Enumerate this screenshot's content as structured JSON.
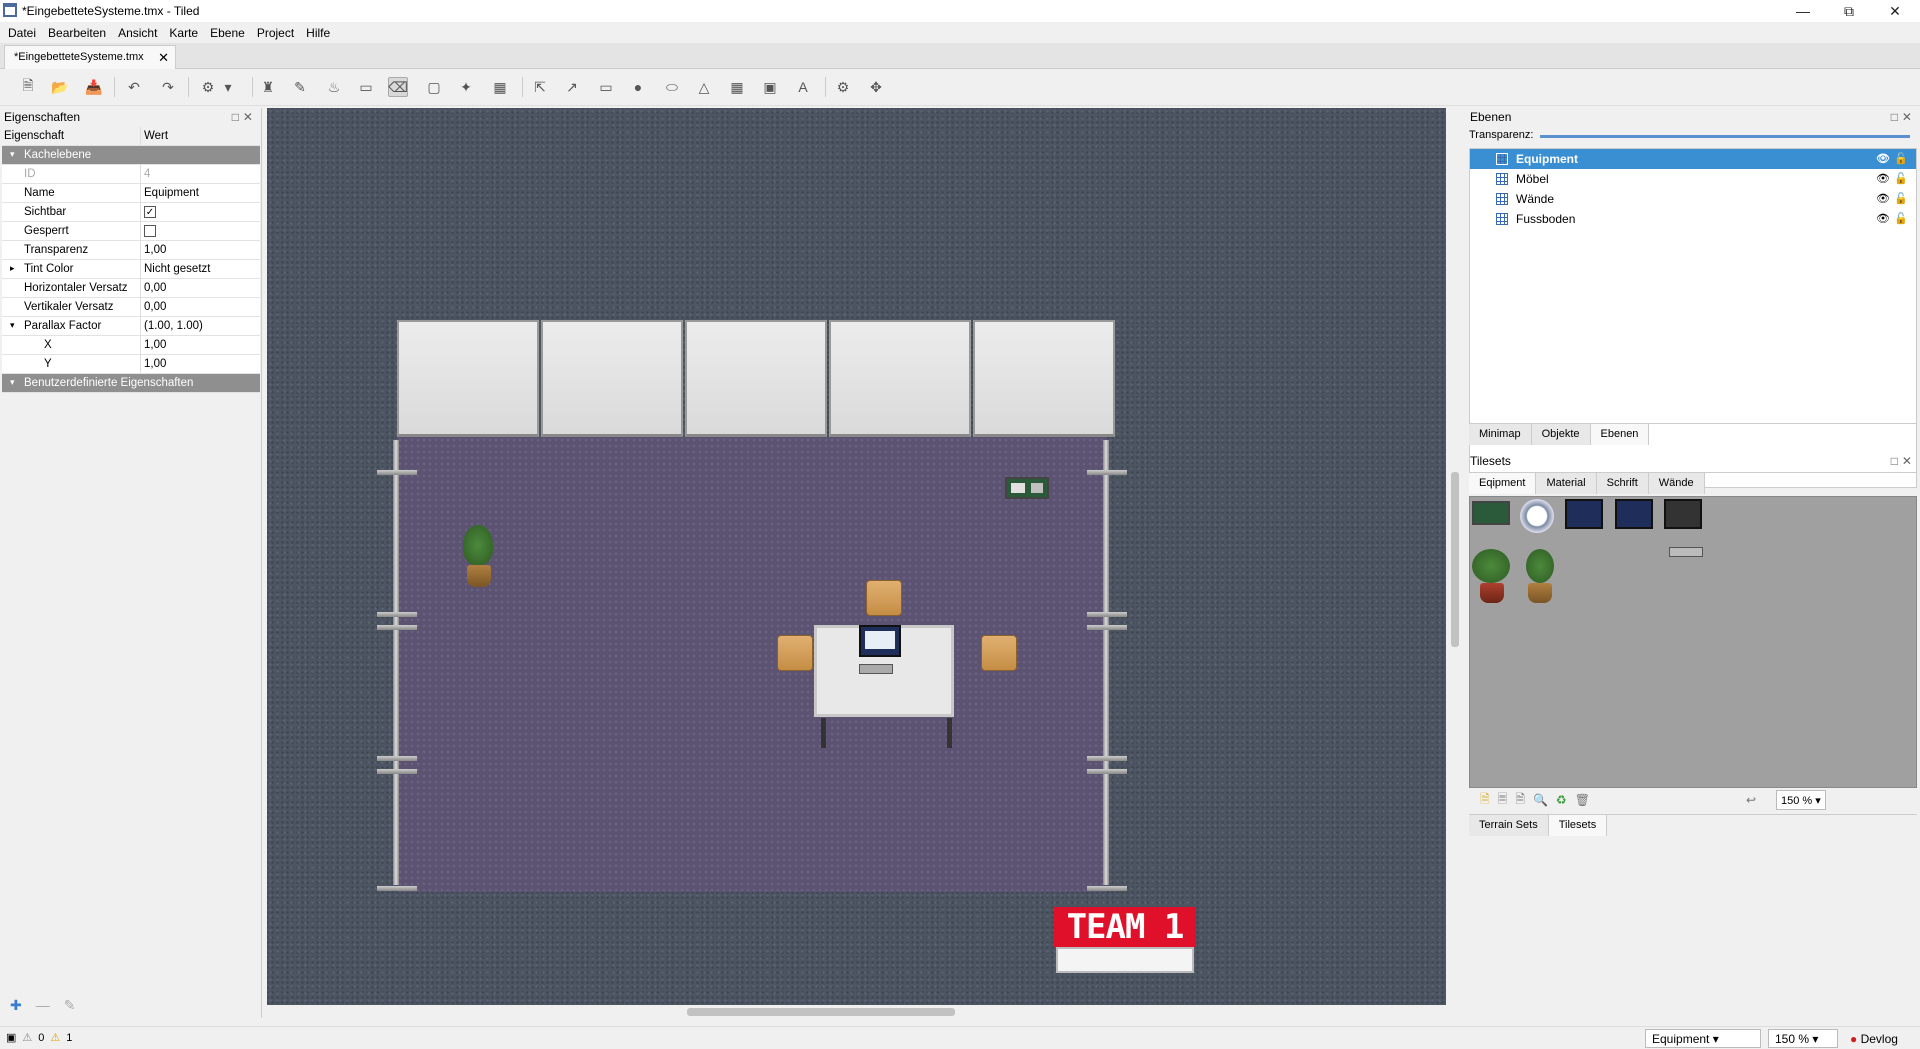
{
  "window": {
    "title": "*EingebetteteSysteme.tmx - Tiled"
  },
  "menu": [
    "Datei",
    "Bearbeiten",
    "Ansicht",
    "Karte",
    "Ebene",
    "Project",
    "Hilfe"
  ],
  "document_tab": {
    "label": "*EingebetteteSysteme.tmx"
  },
  "properties_panel": {
    "title": "Eigenschaften",
    "col_property": "Eigenschaft",
    "col_value": "Wert",
    "group_main": "Kachelebene",
    "rows": [
      {
        "key": "ID",
        "value": "4"
      },
      {
        "key": "Name",
        "value": "Equipment"
      },
      {
        "key": "Sichtbar",
        "value": "✓"
      },
      {
        "key": "Gesperrt",
        "value": ""
      },
      {
        "key": "Transparenz",
        "value": "1,00"
      },
      {
        "key": "Tint Color",
        "value": "Nicht gesetzt"
      },
      {
        "key": "Horizontaler Versatz",
        "value": "0,00"
      },
      {
        "key": "Vertikaler Versatz",
        "value": "0,00"
      },
      {
        "key": "Parallax Factor",
        "value": "(1.00, 1.00)"
      },
      {
        "key": "X",
        "value": "1,00"
      },
      {
        "key": "Y",
        "value": "1,00"
      }
    ],
    "group_custom": "Benutzerdefinierte Eigenschaften"
  },
  "map": {
    "sign_text": "TEAM 1"
  },
  "layers_panel": {
    "title": "Ebenen",
    "transparency_label": "Transparenz:",
    "layers": [
      {
        "name": "Equipment",
        "selected": true
      },
      {
        "name": "Möbel",
        "selected": false
      },
      {
        "name": "Wände",
        "selected": false
      },
      {
        "name": "Fussboden",
        "selected": false
      }
    ],
    "tabs": [
      "Minimap",
      "Objekte",
      "Ebenen"
    ],
    "active_tab": "Ebenen"
  },
  "tilesets_panel": {
    "title": "Tilesets",
    "tabs": [
      "Eqipment",
      "Material",
      "Schrift",
      "Wände"
    ],
    "active_tab": "Eqipment",
    "zoom": "150 %",
    "bottom_tabs": [
      "Terrain Sets",
      "Tilesets"
    ],
    "active_bottom_tab": "Tilesets"
  },
  "statusbar": {
    "errors": "0",
    "warnings": "1",
    "layer_select": "Equipment",
    "zoom": "150 %",
    "devlog": "Devlog"
  },
  "colors": {
    "selection": "#3a8fd3",
    "team_sign": "#e0102a",
    "floor": "#5b5371",
    "background": "#4c5561"
  }
}
